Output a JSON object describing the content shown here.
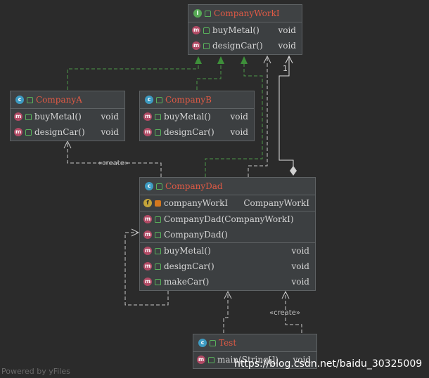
{
  "nodes": {
    "companyWorkI": {
      "badge": "I",
      "title": "CompanyWorkI",
      "methods": [
        {
          "badge": "m",
          "name": "buyMetal()",
          "type": "void"
        },
        {
          "badge": "m",
          "name": "designCar()",
          "type": "void"
        }
      ]
    },
    "companyA": {
      "badge": "c",
      "title": "CompanyA",
      "methods": [
        {
          "badge": "m",
          "name": "buyMetal()",
          "type": "void"
        },
        {
          "badge": "m",
          "name": "designCar()",
          "type": "void"
        }
      ]
    },
    "companyB": {
      "badge": "c",
      "title": "CompanyB",
      "methods": [
        {
          "badge": "m",
          "name": "buyMetal()",
          "type": "void"
        },
        {
          "badge": "m",
          "name": "designCar()",
          "type": "void"
        }
      ]
    },
    "companyDad": {
      "badge": "c",
      "title": "CompanyDad",
      "fields": [
        {
          "badge": "f",
          "name": "companyWorkI",
          "type": "CompanyWorkI"
        }
      ],
      "constructors": [
        {
          "badge": "m",
          "name": "CompanyDad(CompanyWorkI)"
        },
        {
          "badge": "m",
          "name": "CompanyDad()"
        }
      ],
      "methods": [
        {
          "badge": "m",
          "name": "buyMetal()",
          "type": "void"
        },
        {
          "badge": "m",
          "name": "designCar()",
          "type": "void"
        },
        {
          "badge": "m",
          "name": "makeCar()",
          "type": "void"
        }
      ]
    },
    "test": {
      "badge": "c",
      "title": "Test",
      "methods": [
        {
          "badge": "m",
          "name": "main(String[])",
          "type": "void"
        }
      ]
    }
  },
  "edge_labels": {
    "create_a": "«create»",
    "create_test": "«create»",
    "multiplicity": "1"
  },
  "watermark": "Powered by yFiles",
  "url": "https://blog.csdn.net/baidu_30325009",
  "colors": {
    "background": "#2b2b2b",
    "node_fill": "#3c3f41",
    "title": "#e05a45",
    "class_badge": "#3d9bc2",
    "interface_badge": "#57a855",
    "method_badge": "#b24a65",
    "field_badge": "#c4a43a",
    "realization_edge": "#4e9a4a",
    "dependency_edge": "#c9c9c9"
  }
}
